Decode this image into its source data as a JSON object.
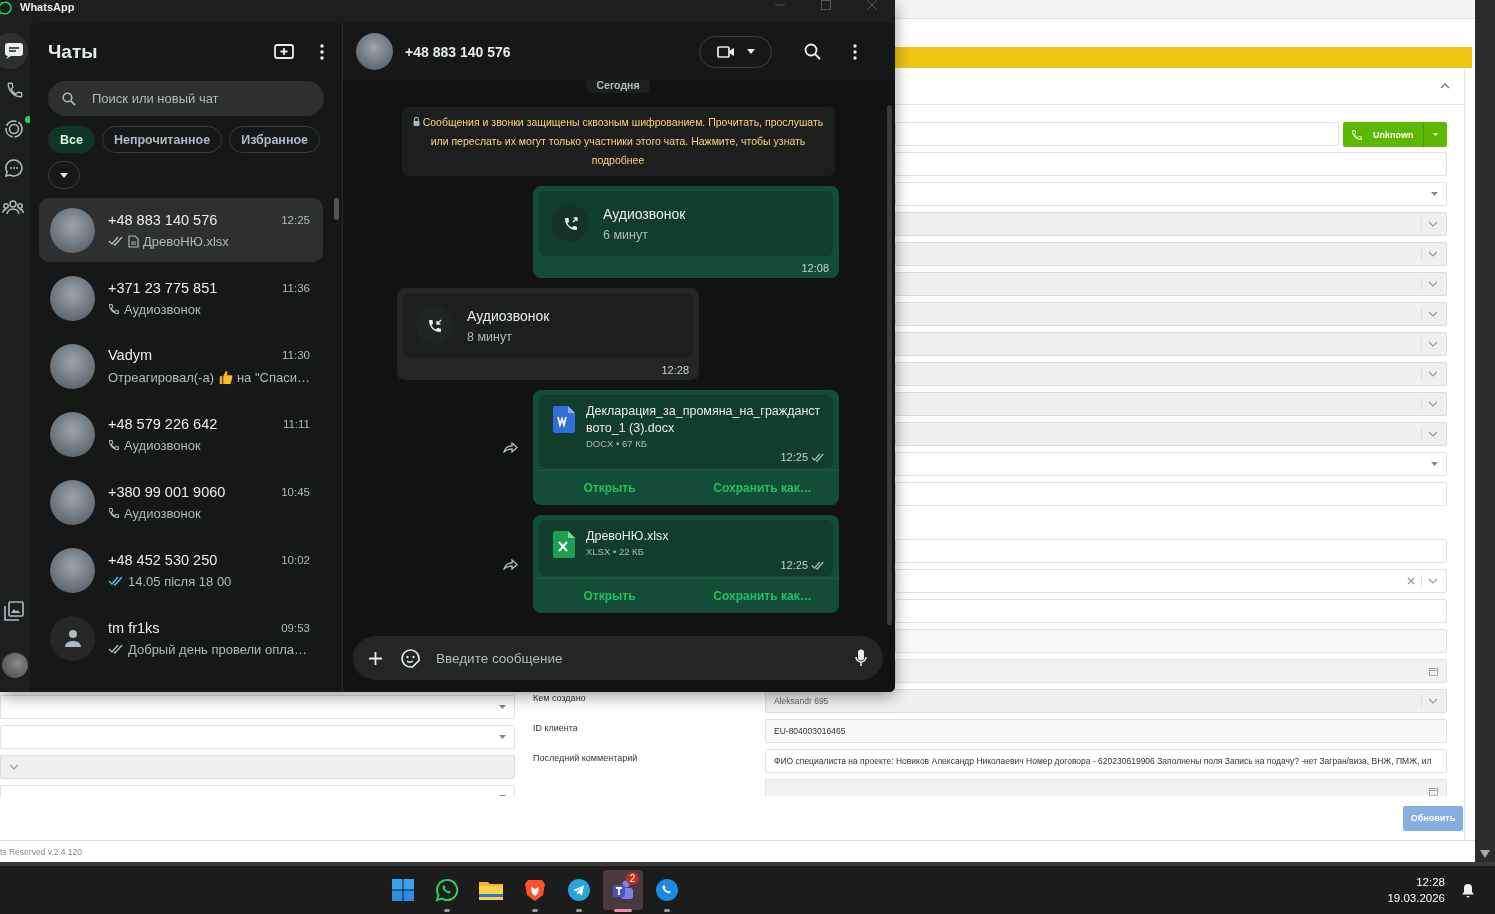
{
  "crm": {
    "sections": [
      {
        "rows": [
          {
            "kind": "phone",
            "button": "Unknown"
          },
          {
            "kind": "input"
          },
          {
            "kind": "select"
          },
          {
            "kind": "locked_select"
          },
          {
            "kind": "locked_select"
          },
          {
            "kind": "locked_select"
          },
          {
            "kind": "locked_select"
          },
          {
            "kind": "locked_select"
          },
          {
            "kind": "locked_select"
          },
          {
            "kind": "locked_select"
          },
          {
            "kind": "locked_select"
          },
          {
            "kind": "select"
          },
          {
            "kind": "input"
          }
        ]
      },
      {
        "rows": [
          {
            "kind": "input"
          },
          {
            "kind": "clearable_select"
          },
          {
            "kind": "input"
          },
          {
            "kind": "readonly"
          },
          {
            "kind": "date"
          },
          {
            "kind": "locked_select",
            "label": "Кем создано",
            "value": "Aleksandr 695",
            "left_field": {
              "kind": "select"
            }
          },
          {
            "kind": "readonly",
            "label": "ID клиента",
            "value": "EU-804003016465",
            "left_field": {
              "kind": "select"
            }
          },
          {
            "kind": "input",
            "label": "Последний комментарий",
            "value": "ФИО специалиста на проекте: Новиков Александр Николаевич  Номер договора - 620230619906 Заполнены поля Запись на подачу? -нет Загран/виза, ВНЖ, ПМЖ, ил",
            "left_field": {
              "kind": "locked_select"
            }
          },
          {
            "kind": "date",
            "left_field": {
              "kind": "select"
            }
          }
        ]
      }
    ],
    "update_button": "Обновить",
    "footer": "ts Reserved v.2.4.120"
  },
  "whatsapp": {
    "title": "WhatsApp",
    "rail": [
      {
        "kind": "chats",
        "selected": true,
        "has_update": false
      },
      {
        "kind": "calls",
        "selected": false,
        "has_update": false
      },
      {
        "kind": "status",
        "selected": false,
        "has_update": true
      },
      {
        "kind": "channels",
        "selected": false,
        "has_update": false
      },
      {
        "kind": "communities",
        "selected": false,
        "has_update": false
      }
    ],
    "rail_bottom": [
      {
        "kind": "media"
      },
      {
        "kind": "profile"
      }
    ],
    "chats_panel": {
      "title": "Чаты",
      "search_placeholder": "Поиск или новый чат",
      "filters": [
        {
          "label": "Все",
          "selected": true
        },
        {
          "label": "Непрочитанное",
          "selected": false
        },
        {
          "label": "Избранное",
          "selected": false
        }
      ],
      "chats": [
        {
          "name": "+48 883 140 576",
          "time": "12:25",
          "kind": "file",
          "preview": "ДревоНЮ.xlsx",
          "delivered": true,
          "read": false,
          "has_photo": true,
          "selected": true
        },
        {
          "name": "+371 23 775 851",
          "time": "11:36",
          "kind": "call",
          "preview": "Аудиозвонок",
          "delivered": false,
          "has_photo": true,
          "selected": false
        },
        {
          "name": "Vadym",
          "time": "11:30",
          "kind": "reaction",
          "preview": "Отреагировал(-а)",
          "preview_after": "на \"Спаси…",
          "delivered": false,
          "has_photo": true,
          "selected": false
        },
        {
          "name": "+48 579 226 642",
          "time": "11:11",
          "kind": "call",
          "preview": "Аудиозвонок",
          "delivered": false,
          "has_photo": true,
          "selected": false
        },
        {
          "name": "+380 99 001 9060",
          "time": "10:45",
          "kind": "call",
          "preview": "Аудиозвонок",
          "delivered": false,
          "has_photo": true,
          "selected": false
        },
        {
          "name": "+48 452 530 250",
          "time": "10:02",
          "kind": "text",
          "preview": "14.05 після 18 00",
          "delivered": true,
          "read": true,
          "has_photo": true,
          "selected": false
        },
        {
          "name": "tm fr1ks",
          "time": "09:53",
          "kind": "text",
          "preview": "Добрый день провели опла…",
          "delivered": true,
          "read": false,
          "has_photo": false,
          "selected": false
        }
      ]
    },
    "conversation": {
      "name": "+48 883 140 576",
      "date_chip": "Сегодня",
      "notice": "Сообщения и звонки защищены сквозным шифрованием. Прочитать, прослушать или переслать их могут только участники этого чата. Нажмите, чтобы узнать подробнее",
      "messages": [
        {
          "kind": "call",
          "outgoing": true,
          "title": "Аудиозвонок",
          "subtitle": "6 минут",
          "time": "12:08"
        },
        {
          "kind": "call",
          "outgoing": false,
          "title": "Аудиозвонок",
          "subtitle": "8 минут",
          "time": "12:28"
        },
        {
          "kind": "document",
          "outgoing": true,
          "file": {
            "kind": "word",
            "name": "Декларация_за_промяна_на_гражданството_1 (3).docx",
            "meta": "DOCX • 67 КБ"
          },
          "time": "12:25",
          "delivered": true,
          "actions": [
            "Открыть",
            "Сохранить как…"
          ]
        },
        {
          "kind": "document",
          "outgoing": true,
          "file": {
            "kind": "spreadsheet",
            "name": "ДревоНЮ.xlsx",
            "meta": "XLSX • 22 КБ"
          },
          "time": "12:25",
          "delivered": true,
          "actions": [
            "Открыть",
            "Сохранить как…"
          ]
        }
      ],
      "composer_placeholder": "Введите сообщение"
    }
  },
  "taskbar": {
    "apps": [
      {
        "kind": "start",
        "running": false,
        "selected": false
      },
      {
        "kind": "whatsapp",
        "running": true,
        "selected": false
      },
      {
        "kind": "folder",
        "running": false,
        "selected": false
      },
      {
        "kind": "lion",
        "running": true,
        "selected": false
      },
      {
        "kind": "telegram",
        "running": true,
        "selected": false
      },
      {
        "kind": "teams",
        "running": true,
        "selected": true,
        "badge": "2"
      },
      {
        "kind": "phone",
        "running": true,
        "selected": false
      }
    ],
    "time": "12:28",
    "date": "19.03.2026"
  }
}
